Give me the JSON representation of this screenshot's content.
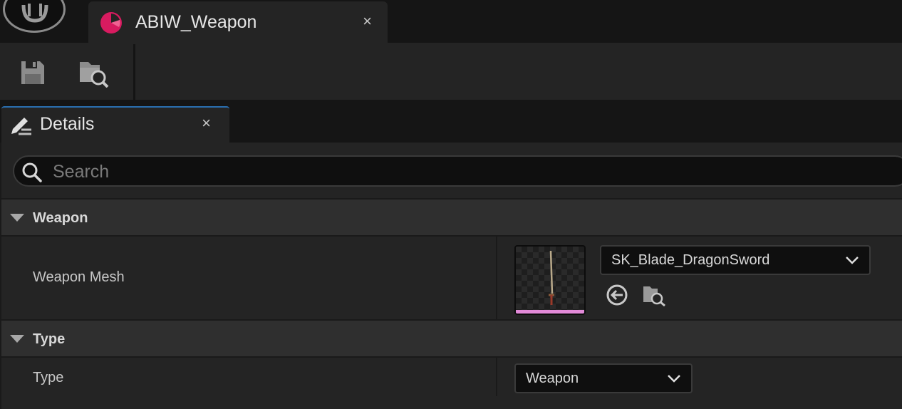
{
  "window": {
    "asset_tab_label": "ABIW_Weapon",
    "asset_tab_close": "×",
    "asset_icon": "animation-pie-icon",
    "accent_color": "#d81b60"
  },
  "toolbar": {
    "items": [
      {
        "icon": "save-icon"
      },
      {
        "icon": "browse-to-asset-icon"
      }
    ]
  },
  "details_panel": {
    "tab_label": "Details",
    "tab_close": "×",
    "tab_icon": "details-pencil-icon",
    "search": {
      "placeholder": "Search",
      "value": ""
    },
    "categories": [
      {
        "label": "Weapon",
        "properties": [
          {
            "label": "Weapon Mesh",
            "value": "SK_Blade_DragonSword",
            "thumbnail_icon": "sword-thumbnail",
            "asset_type_color": "#e28ad8",
            "actions": [
              "use-selected-icon",
              "browse-icon"
            ]
          }
        ]
      },
      {
        "label": "Type",
        "properties": [
          {
            "label": "Type",
            "value": "Weapon"
          }
        ]
      }
    ]
  }
}
